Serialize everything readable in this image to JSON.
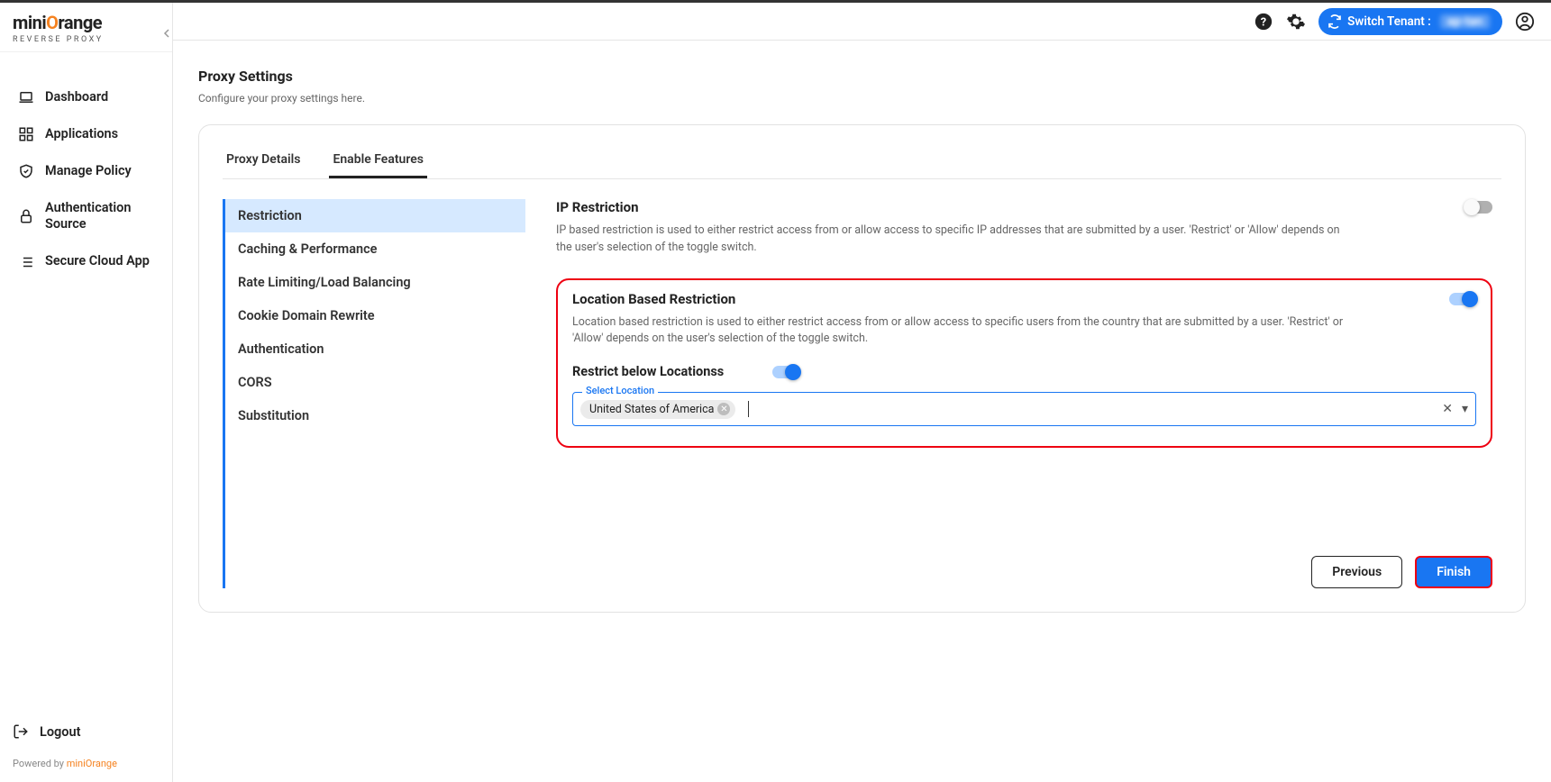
{
  "brand": {
    "name_pre": "mini",
    "name_mid": "O",
    "name_post": "range",
    "sub": "REVERSE PROXY"
  },
  "header": {
    "switch_tenant": "Switch Tenant :",
    "tenant_value": "ap-tan"
  },
  "sidebar": {
    "items": [
      {
        "label": "Dashboard"
      },
      {
        "label": "Applications"
      },
      {
        "label": "Manage Policy"
      },
      {
        "label": "Authentication Source"
      },
      {
        "label": "Secure Cloud App"
      }
    ],
    "logout": "Logout",
    "powered_pre": "Powered by ",
    "powered_link": "miniOrange"
  },
  "page": {
    "title": "Proxy Settings",
    "subtitle": "Configure your proxy settings here."
  },
  "tabs": [
    {
      "label": "Proxy Details"
    },
    {
      "label": "Enable Features"
    }
  ],
  "feature_nav": [
    {
      "label": "Restriction"
    },
    {
      "label": "Caching & Performance"
    },
    {
      "label": "Rate Limiting/Load Balancing"
    },
    {
      "label": "Cookie Domain Rewrite"
    },
    {
      "label": "Authentication"
    },
    {
      "label": "CORS"
    },
    {
      "label": "Substitution"
    }
  ],
  "sections": {
    "ip": {
      "title": "IP Restriction",
      "desc": "IP based restriction is used to either restrict access from or allow access to specific IP addresses that are submitted by a user. 'Restrict' or 'Allow' depends on the user's selection of the toggle switch."
    },
    "loc": {
      "title": "Location Based Restriction",
      "desc": "Location based restriction is used to either restrict access from or allow access to specific users from the country that are submitted by a user. 'Restrict' or 'Allow' depends on the user's selection of the toggle switch.",
      "sub_label": "Restrict below Locationss",
      "select_label": "Select Location",
      "chip": "United States of America"
    }
  },
  "buttons": {
    "prev": "Previous",
    "finish": "Finish"
  }
}
